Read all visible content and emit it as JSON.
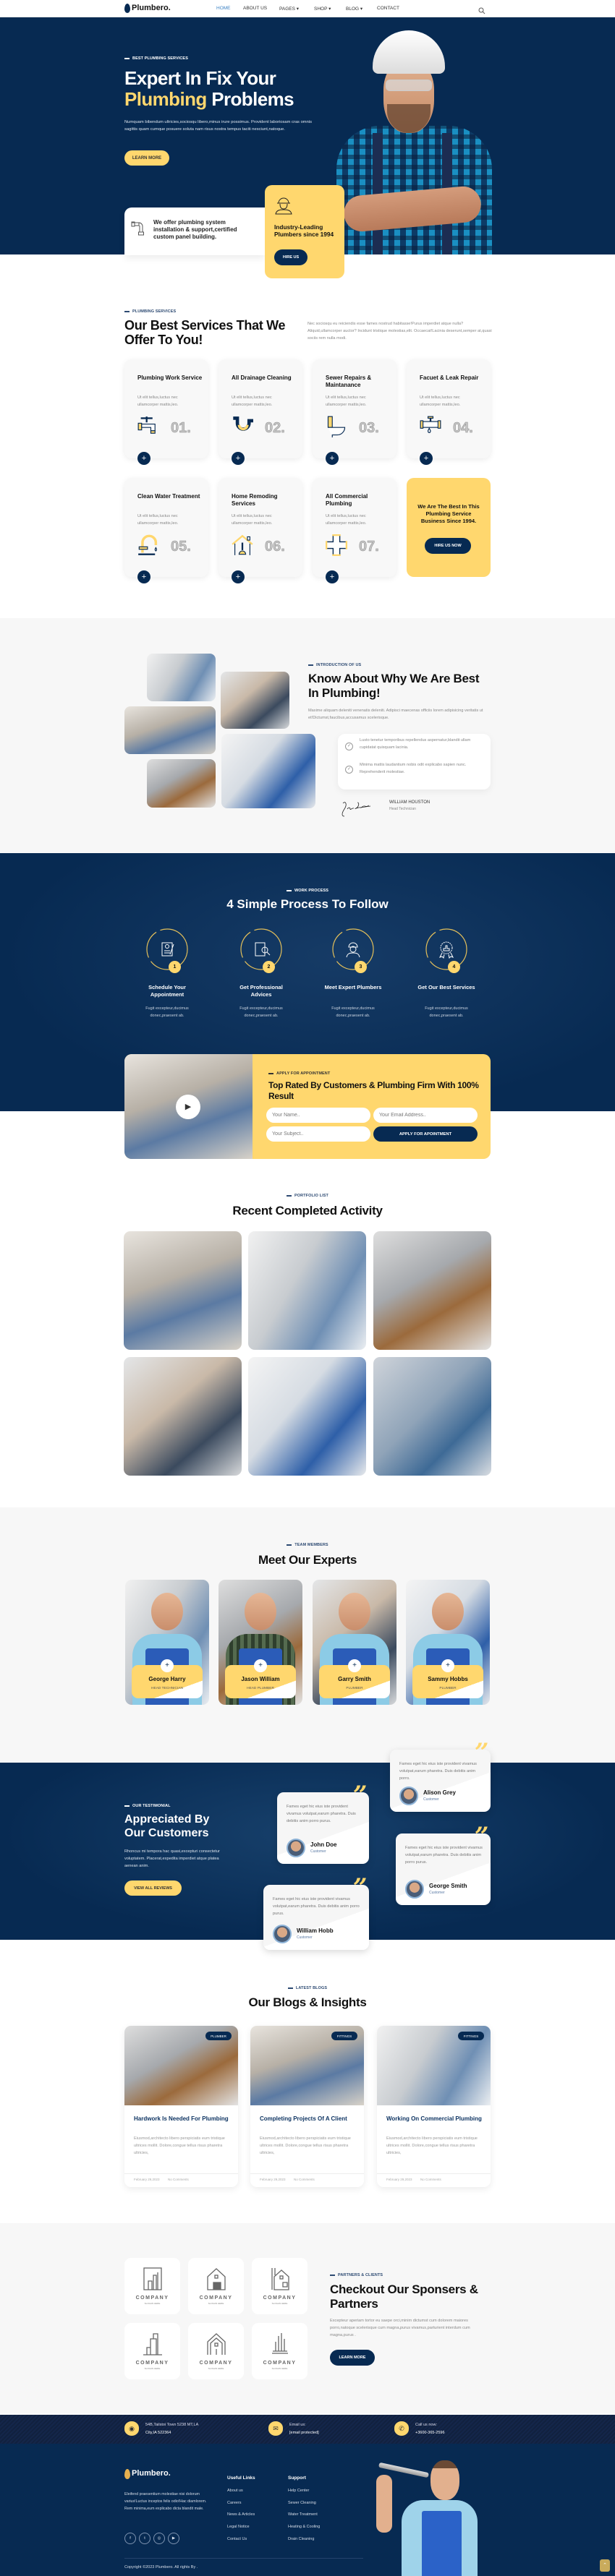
{
  "colors": {
    "navy": "#072a52",
    "yellow": "#ffd76e",
    "light_bg": "#f7f7f7",
    "blue_active": "#3b82c4"
  },
  "header": {
    "logo": "Plumbero.",
    "nav": [
      {
        "label": "HOME",
        "active": true
      },
      {
        "label": "ABOUT US"
      },
      {
        "label": "PAGES ▾"
      },
      {
        "label": "SHOP ▾"
      },
      {
        "label": "BLOG ▾"
      },
      {
        "label": "CONTACT"
      }
    ],
    "search_icon": "search-icon"
  },
  "hero": {
    "tagline": "BEST PLUMBING SERVICES",
    "title_line1": "Expert In Fix Your",
    "title_highlight": "Plumbing",
    "title_rest": "Problems",
    "description": "Numquam bibendum ultricies,sociosqu libero,minus irure possimus. Provident laboriosam cras omnis sagittis quam cumque posuere soluta nam risus nostra tempus taciti nesciunt,natoque.",
    "button": "LEARN MORE",
    "offer_text": "We offer plumbing system installation & support,certified custom panel building.",
    "badge_text": "Industry-Leading Plumbers since 1994",
    "badge_button": "HIRE US"
  },
  "services": {
    "label": "PLUMBING SERVICES",
    "title": "Our Best Services That We Offer To You!",
    "description": "Nec sociosqu eu reiciendis esse fames nostrud habitasse!Purus imperdiet atque nulla? Aliquid,ullamcorper auctor? Incidunt tristique molestias,elit. Occaecat!Lacinia deserunt,semper at,quasi sociis rem nulla modi.",
    "items": [
      {
        "title": "Plumbing Work Service",
        "desc": "Ut elit tellus,luctus nec ullamcorper mattis,leo.",
        "number": "01.",
        "icon": "faucet-icon"
      },
      {
        "title": "All Drainage Cleaning",
        "desc": "Ut elit tellus,luctus nec ullamcorper mattis,leo.",
        "number": "02.",
        "icon": "drain-pipe-icon"
      },
      {
        "title": "Sewer Repairs & Maintanance",
        "desc": "Ut elit tellus,luctus nec ullamcorper mattis,leo.",
        "number": "03.",
        "icon": "toilet-icon"
      },
      {
        "title": "Facuet & Leak Repair",
        "desc": "Ut elit tellus,luctus nec ullamcorper mattis,leo.",
        "number": "04.",
        "icon": "leak-valve-icon"
      },
      {
        "title": "Clean Water Treatment",
        "desc": "Ut elit tellus,luctus nec ullamcorper mattis,leo.",
        "number": "05.",
        "icon": "tap-icon"
      },
      {
        "title": "Home Remoding Services",
        "desc": "Ut elit tellus,luctus nec ullamcorper mattis,leo.",
        "number": "06.",
        "icon": "house-plunger-icon"
      },
      {
        "title": "All Commercial Plumbing",
        "desc": "Ut elit tellus,luctus nec ullamcorper mattis,leo.",
        "number": "07.",
        "icon": "pipe-cross-icon"
      }
    ],
    "promo": {
      "text": "We Are The Best In This Plumbing Service Business Since 1994.",
      "button": "HIRE US NOW"
    }
  },
  "about": {
    "label": "INTRODUCTION OF US",
    "title": "Know About Why We Are Best In Plumbing!",
    "description": "Maxime aliquam deleniti venenatis deleniti. Adipisci maecenas officiis lorem adipisicing veritatis ut et!Dictumst,faucibus,accusamus scelerisque.",
    "points": [
      "Lusto tenetur temporibus repellendus aspernatur,blandit ullam cupidatat quisquam lacinia.",
      "Minima mattis laudantium nobis odit explicabo sapien nunc. Reprehenderit molestiae."
    ],
    "signer_name": "WILLIAM HOUSTON",
    "signer_role": "Head Technician"
  },
  "process": {
    "label": "WORK PROCESS",
    "title": "4 Simple Process To Follow",
    "steps": [
      {
        "number": "1",
        "title": "Schedule Your Appointment",
        "desc": "Fugit excepteur,ducimus donec,praesent ab.",
        "icon": "appointment-form-icon"
      },
      {
        "number": "2",
        "title": "Get Professional Advices",
        "desc": "Fugit excepteur,ducimus donec,praesent ab.",
        "icon": "document-search-icon"
      },
      {
        "number": "3",
        "title": "Meet Expert Plumbers",
        "desc": "Fugit excepteur,ducimus donec,praesent ab.",
        "icon": "plumber-worker-icon"
      },
      {
        "number": "4",
        "title": "Get Our Best Services",
        "desc": "Fugit excepteur,ducimus donec,praesent ab.",
        "icon": "thumbs-up-badge-icon"
      }
    ]
  },
  "appointment": {
    "label": "APPLY FOR APPOINTMENT",
    "title": "Top Rated By Customers & Plumbing Firm With 100% Result",
    "name_placeholder": "Your Name..",
    "email_placeholder": "Your Email Address..",
    "subject_placeholder": "Your Subject..",
    "button": "APPLY FOR APOINTMENT"
  },
  "portfolio": {
    "label": "PORTFOLIO LIST",
    "title": "Recent Completed Activity"
  },
  "team": {
    "label": "TEAM MEMBERS",
    "title": "Meet Our Experts",
    "members": [
      {
        "name": "George Harry",
        "role": "HEAD TECHNICIAN"
      },
      {
        "name": "Jason William",
        "role": "HEAD PLUMBER"
      },
      {
        "name": "Garry Smith",
        "role": "PLUMBER"
      },
      {
        "name": "Sammy Hobbs",
        "role": "PLUMBER"
      }
    ]
  },
  "testimonials": {
    "label": "OUR TESTIMONIAL",
    "title": "Appreciated By Our Customers",
    "description": "Rhoncus mi tempora hac quasi,excepturi consectetur voluptatem. Placerat,expedita imperdiet atque platea aenean anim.",
    "button": "VIEW ALL REVIEWS",
    "reviews": [
      {
        "text": "Fames eget hic eius iste provident vivamus volutpat,earum pharetra. Duis debitis anim porro purus.",
        "name": "John Doe",
        "role": "Customer"
      },
      {
        "text": "Fames eget hic eius iste provident vivamus volutpat,earum pharetra. Duis debitis anim porro.",
        "name": "Alison Grey",
        "role": "Customer"
      },
      {
        "text": "Fames eget hic eius iste provident vivamus volutpat,earum pharetra. Duis debitis anim porro purus.",
        "name": "George Smith",
        "role": "Customer"
      },
      {
        "text": "Fames eget hic eius iste provident vivamus volutpat,earum pharetra. Duis debitis anim porro purus.",
        "name": "William Hobb",
        "role": "Customer"
      }
    ]
  },
  "blogs": {
    "label": "LATEST BLOGS",
    "title": "Our Blogs & Insights",
    "posts": [
      {
        "tag": "PLUMBER",
        "title": "Hardwork Is Needed For Plumbing",
        "excerpt": "Eiusmod,architecto libero perspiciatis eum tristique ultrices mollit. Dolore,congue tellus risus pharetra ultricies,",
        "date": "February 29,2023",
        "comments": "No Comments"
      },
      {
        "tag": "FITTINGS",
        "title": "Completing Projects Of A Client",
        "excerpt": "Eiusmod,architecto libero perspiciatis eum tristique ultrices mollit. Dolore,congue tellus risus pharetra ultricies,",
        "date": "February 29,2023",
        "comments": "No Comments"
      },
      {
        "tag": "FITTINGS",
        "title": "Working On Commercial Plumbing",
        "excerpt": "Eiusmod,architecto libero perspiciatis eum tristique ultrices mollit. Dolore,congue tellus risus pharetra ultricies,",
        "date": "February 29,2023",
        "comments": "No Comments"
      }
    ]
  },
  "partners": {
    "label": "PARTNERS & CLIENTS",
    "title": "Checkout Our Sponsers & Partners",
    "description": "Excepteur aperiam tortor eu saepe orci,minim dictumst cum dolorem maiores porro,natoque scelerisque cum magna,purus vivamus,parturient interdum cum magna,purus .",
    "button": "LEARN MORE",
    "logos": [
      {
        "name": "COMPANY",
        "slogan": "SLOGAN HERE"
      },
      {
        "name": "COMPANY",
        "slogan": "SLOGAN HERE"
      },
      {
        "name": "COMPANY",
        "slogan": "SLOGAN HERE"
      },
      {
        "name": "COMPANY",
        "slogan": "SLOGAN HERE"
      },
      {
        "name": "COMPANY",
        "slogan": "SLOGAN HERE"
      },
      {
        "name": "COMPANY",
        "slogan": "SLOGAN HERE"
      }
    ]
  },
  "footer": {
    "contacts": [
      {
        "icon": "location-icon",
        "line1": "54B,Tailstoi Town 5238 MT,LA",
        "line2": "City,IA 522364"
      },
      {
        "icon": "mail-icon",
        "line1": "Email us:",
        "line2": "[email protected]"
      },
      {
        "icon": "phone-icon",
        "line1": "Call us now:",
        "line2": "+3600-365-2596"
      }
    ],
    "logo": "Plumbero.",
    "description": "Eleifend praesentium molestiae nisi dolorum varius!Luctus inceptos felis odio!Hac diamlorem. Rem minima,eum explicabo dicta blandit male.",
    "socials": [
      {
        "icon": "facebook-icon",
        "glyph": "f"
      },
      {
        "icon": "twitter-icon",
        "glyph": "t"
      },
      {
        "icon": "instagram-icon",
        "glyph": "◎"
      },
      {
        "icon": "youtube-icon",
        "glyph": "▶"
      }
    ],
    "useful_title": "Useful Links",
    "useful_links": [
      "About us",
      "Careers",
      "News & Articles",
      "Legal Notice",
      "Contact Us"
    ],
    "support_title": "Support",
    "support_links": [
      "Help Center",
      "Sewer Cleaning",
      "Water Treatment",
      "Heating & Cooling",
      "Drain Cleaning"
    ],
    "copyright": "Copyright ©2023 Plumbero. All rights By  .",
    "back_to_top": "⌃"
  }
}
